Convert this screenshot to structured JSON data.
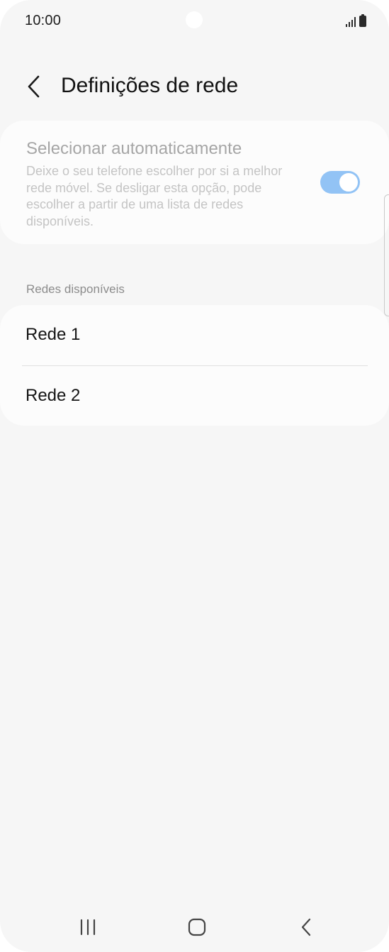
{
  "status_bar": {
    "time": "10:00"
  },
  "header": {
    "back_icon": "chevron-left-icon",
    "title": "Definições de rede"
  },
  "auto_select": {
    "title": "Selecionar automaticamente",
    "description": "Deixe o seu telefone escolher por si a melhor rede móvel. Se desligar esta opção, pode escolher a partir de uma lista de redes disponíveis.",
    "enabled": true,
    "accent_color": "#92c3f5"
  },
  "available_networks": {
    "section_label": "Redes disponíveis",
    "items": [
      {
        "label": "Rede 1"
      },
      {
        "label": "Rede 2"
      }
    ]
  },
  "nav_bar": {
    "recent_icon": "recent-apps-icon",
    "home_icon": "home-icon",
    "back_icon": "back-icon"
  }
}
